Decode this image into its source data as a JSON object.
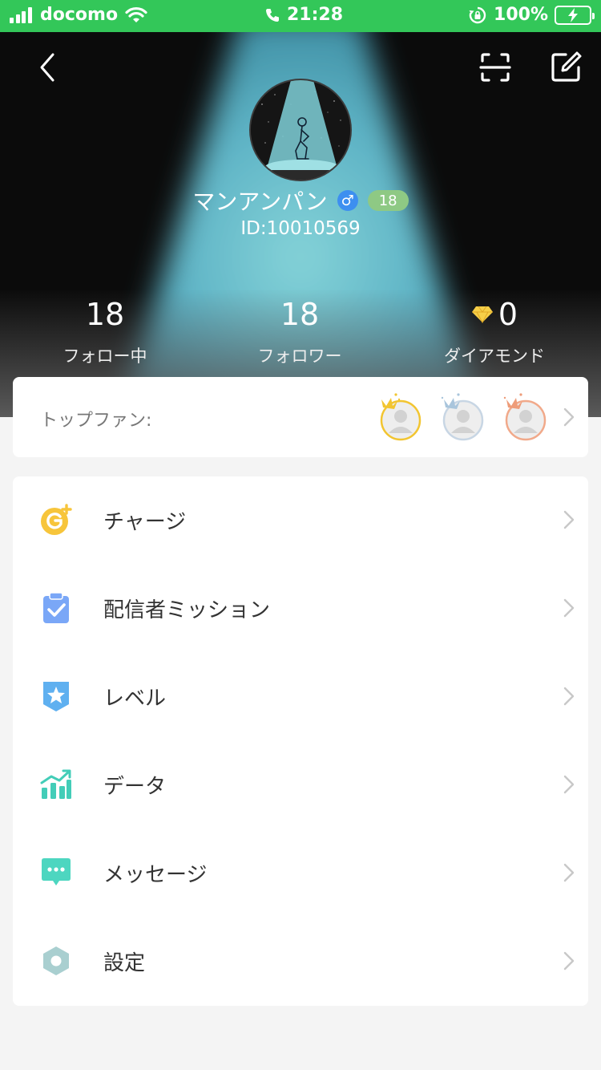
{
  "status_bar": {
    "carrier": "docomo",
    "time": "21:28",
    "battery": "100%"
  },
  "profile": {
    "name": "マンアンパン",
    "gender_symbol": "♂",
    "level": "18",
    "user_id": "ID:10010569"
  },
  "stats": [
    {
      "value": "18",
      "label": "フォロー中"
    },
    {
      "value": "18",
      "label": "フォロワー"
    },
    {
      "value": "0",
      "label": "ダイアモンド"
    }
  ],
  "top_fans": {
    "label": "トップファン:",
    "ring_colors": [
      "#f2c531",
      "#c8d6e4",
      "#f1a98a"
    ]
  },
  "menu": [
    {
      "label": "チャージ",
      "icon": "charge-g-icon",
      "color": "#f7c53b"
    },
    {
      "label": "配信者ミッション",
      "icon": "clipboard-check-icon",
      "color": "#7aa7f7"
    },
    {
      "label": "レベル",
      "icon": "star-shield-icon",
      "color": "#5fb0f0"
    },
    {
      "label": "データ",
      "icon": "chart-trend-icon",
      "color": "#43cdb8"
    },
    {
      "label": "メッセージ",
      "icon": "chat-bubble-icon",
      "color": "#4dd6c0"
    },
    {
      "label": "設定",
      "icon": "settings-hexagon-icon",
      "color": "#a9cfd0"
    }
  ],
  "colors": {
    "status_bar": "#33c759",
    "beam": "#7cc8d3"
  }
}
